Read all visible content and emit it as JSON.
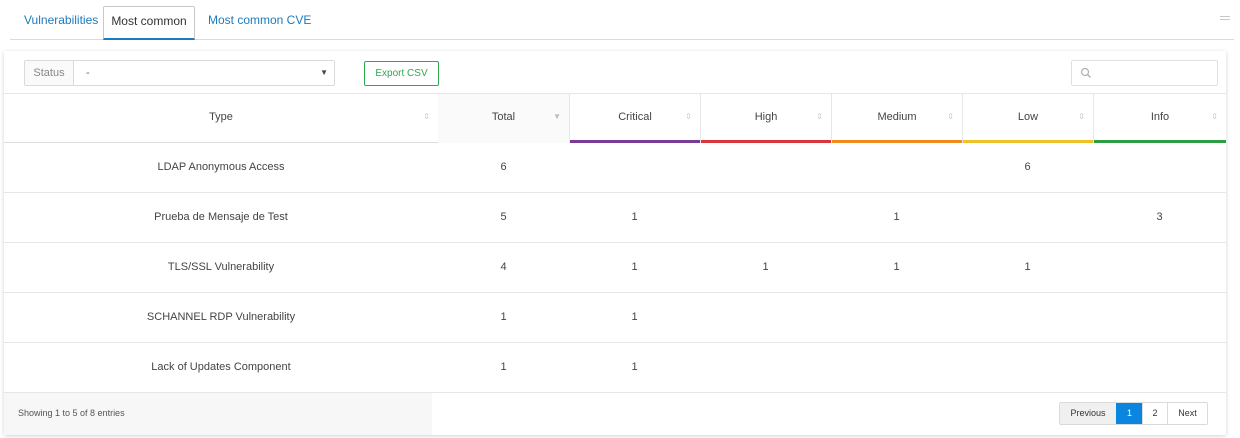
{
  "tabs": [
    {
      "label": "Vulnerabilities"
    },
    {
      "label": "Most common"
    },
    {
      "label": "Most common CVE"
    }
  ],
  "toolbar": {
    "status_label": "Status",
    "status_value": "-",
    "export_label": "Export CSV",
    "search_placeholder": ""
  },
  "columns": [
    {
      "label": "Type"
    },
    {
      "label": "Total"
    },
    {
      "label": "Critical",
      "color": "#7b3a96"
    },
    {
      "label": "High",
      "color": "#d9363e"
    },
    {
      "label": "Medium",
      "color": "#ef8a1c"
    },
    {
      "label": "Low",
      "color": "#efc12b"
    },
    {
      "label": "Info",
      "color": "#2e9e44"
    }
  ],
  "rows": [
    {
      "type": "LDAP Anonymous Access",
      "total": "6",
      "critical": "",
      "high": "",
      "medium": "",
      "low": "6",
      "info": ""
    },
    {
      "type": "Prueba de Mensaje de Test",
      "total": "5",
      "critical": "1",
      "high": "",
      "medium": "1",
      "low": "",
      "info": "3"
    },
    {
      "type": "TLS/SSL Vulnerability",
      "total": "4",
      "critical": "1",
      "high": "1",
      "medium": "1",
      "low": "1",
      "info": ""
    },
    {
      "type": "SCHANNEL RDP Vulnerability",
      "total": "1",
      "critical": "1",
      "high": "",
      "medium": "",
      "low": "",
      "info": ""
    },
    {
      "type": "Lack of Updates Component",
      "total": "1",
      "critical": "1",
      "high": "",
      "medium": "",
      "low": "",
      "info": ""
    }
  ],
  "footer": {
    "info": "Showing 1 to 5 of 8 entries",
    "pagination": {
      "previous": "Previous",
      "pages": [
        "1",
        "2"
      ],
      "next": "Next",
      "current": "1"
    }
  }
}
